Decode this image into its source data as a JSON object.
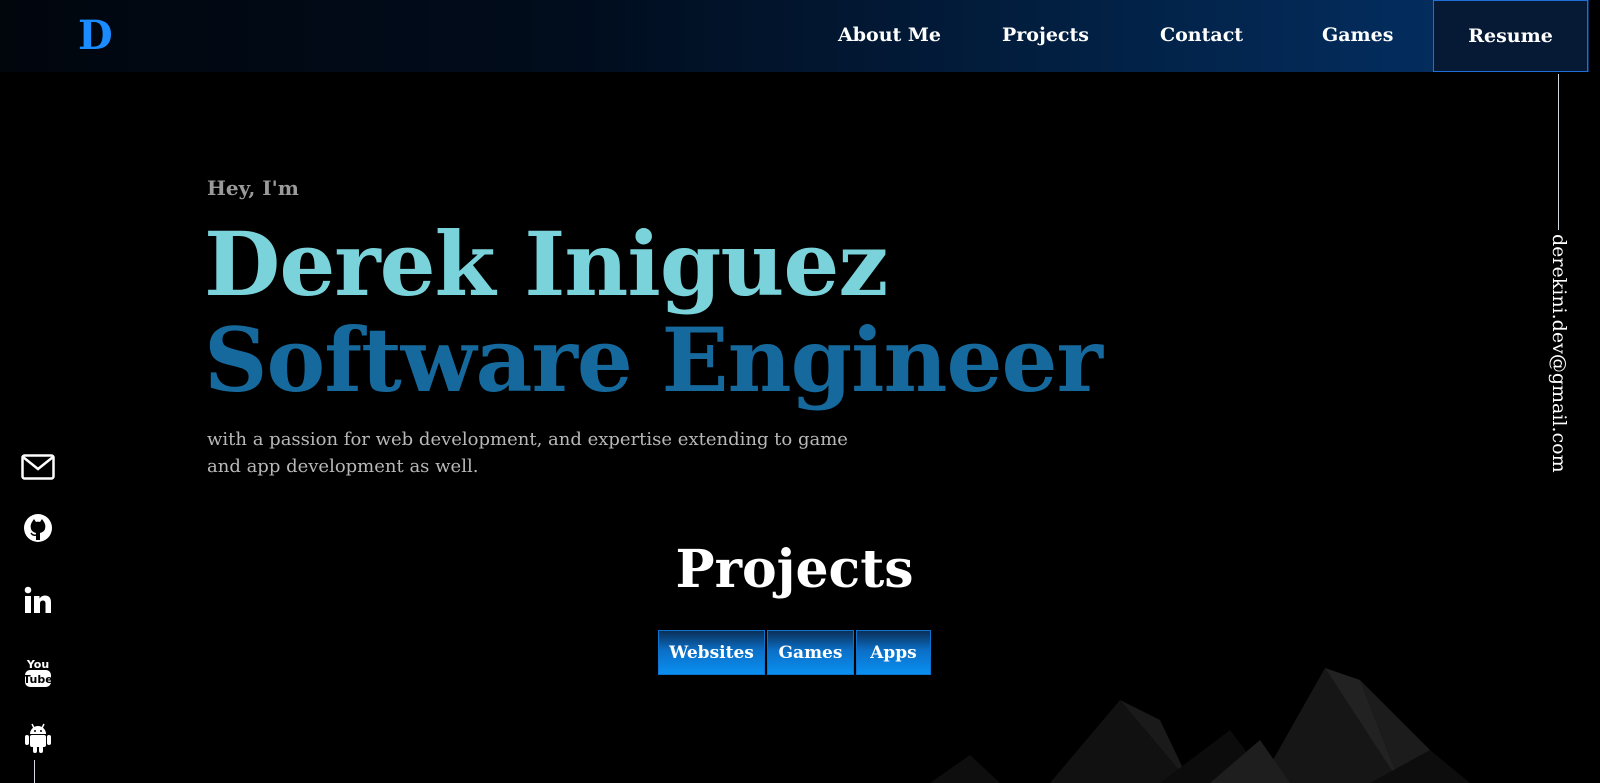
{
  "logo": {
    "letter": "D"
  },
  "nav": {
    "links": [
      "About Me",
      "Projects",
      "Contact",
      "Games"
    ],
    "resume_label": "Resume"
  },
  "contact": {
    "email": "derekini.dev@gmail.com"
  },
  "hero": {
    "greeting": "Hey, I'm",
    "name": "Derek Iniguez",
    "role": "Software Engineer",
    "tagline": "with a passion for web development, and expertise extending to game and app development as well."
  },
  "projects": {
    "title": "Projects",
    "filters": [
      "Websites",
      "Games",
      "Apps"
    ]
  },
  "social": {
    "icons": [
      "email-icon",
      "github-icon",
      "linkedin-icon",
      "youtube-icon",
      "android-icon"
    ]
  },
  "colors": {
    "accent_blue": "#1a8cff",
    "name_teal": "#7ad3da",
    "role_blue": "#16699d",
    "filter_blue": "#0a8ff0"
  }
}
